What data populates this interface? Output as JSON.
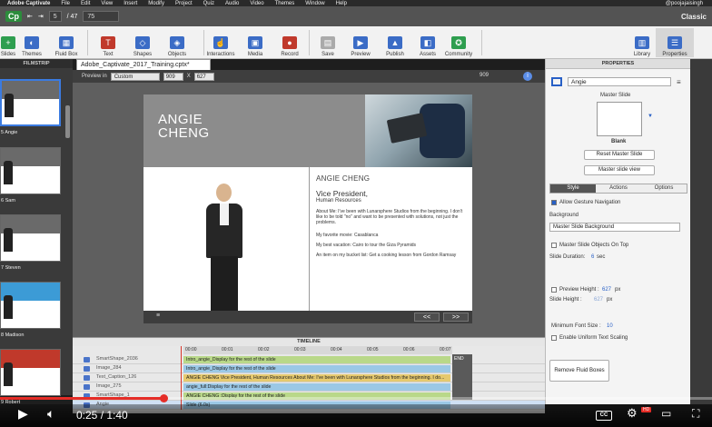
{
  "menubar": {
    "app": "Adobe Captivate",
    "items": [
      "File",
      "Edit",
      "View",
      "Insert",
      "Modify",
      "Project",
      "Quiz",
      "Audio",
      "Video",
      "Themes",
      "Window",
      "Help"
    ],
    "user": "@poojajaisingh"
  },
  "topbar": {
    "logo": "Cp",
    "slide_current": "5",
    "slide_total": "/ 47",
    "zoom": "75",
    "workspace": "Classic"
  },
  "toolbar": {
    "left": [
      {
        "label": "Slides",
        "icon": "plus-icon",
        "color": "#2e9e4f"
      },
      {
        "label": "Themes",
        "icon": "palette-icon",
        "color": "#3b6cc6"
      },
      {
        "label": "Fluid Box",
        "icon": "grid-icon",
        "color": "#3b6cc6"
      },
      {
        "label": "Text",
        "icon": "text-t-icon",
        "color": "#c0392b"
      },
      {
        "label": "Shapes",
        "icon": "shapes-icon",
        "color": "#3b6cc6"
      },
      {
        "label": "Objects",
        "icon": "cube-icon",
        "color": "#3b6cc6"
      },
      {
        "label": "Interactions",
        "icon": "hand-icon",
        "color": "#3b6cc6"
      },
      {
        "label": "Media",
        "icon": "image-icon",
        "color": "#3b6cc6"
      },
      {
        "label": "Record",
        "icon": "mic-icon",
        "color": "#c0392b"
      },
      {
        "label": "Save",
        "icon": "save-icon",
        "color": "#aaaaaa"
      },
      {
        "label": "Preview",
        "icon": "play-icon",
        "color": "#3b6cc6"
      },
      {
        "label": "Publish",
        "icon": "publish-icon",
        "color": "#3b6cc6"
      },
      {
        "label": "Assets",
        "icon": "assets-icon",
        "color": "#3b6cc6"
      },
      {
        "label": "Community",
        "icon": "community-icon",
        "color": "#2e9e4f"
      }
    ],
    "right": [
      {
        "label": "Library",
        "icon": "library-icon",
        "color": "#3b6cc6"
      },
      {
        "label": "Properties",
        "icon": "properties-icon",
        "color": "#3b6cc6"
      }
    ]
  },
  "filmstrip": {
    "title": "FILMSTRIP",
    "thumbs": [
      {
        "label": "5 Angie"
      },
      {
        "label": "6 Sam"
      },
      {
        "label": "7 Steven"
      },
      {
        "label": "8 Madison"
      },
      {
        "label": "9 Robert"
      }
    ]
  },
  "file_tab": "Adobe_Captivate_2017_Training.cptx*",
  "stagebar": {
    "preview_in": "Preview in",
    "device": "Custom",
    "width": "909",
    "x": "X",
    "height": "627",
    "ruler": "909"
  },
  "slide": {
    "name_big_1": "ANGIE",
    "name_big_2": "CHENG",
    "name_small": "ANGIE CHENG",
    "title": "Vice President,",
    "dept": "Human Resources",
    "about": "About Me: I've been with Lunarsphere Studios from the beginning. I don't like to be told \"no\" and want to be presented with solutions, not just the problems.",
    "movie": "My favorite movie: Casablanca",
    "vacation": "My best vacation: Cairo to tour the Giza Pyramids",
    "bucket": "An item on my bucket list: Get a cooking lesson from Gordon Ramsay",
    "prev": "<<",
    "next": ">>",
    "menu": "≡"
  },
  "timeline": {
    "title": "TIMELINE",
    "ticks": [
      "00:00",
      "00:01",
      "00:02",
      "00:03",
      "00:04",
      "00:05",
      "00:06",
      "00:07"
    ],
    "end": "END",
    "rows": [
      {
        "label": "SmartShape_2036",
        "bar": "Intro_angie_Display for the rest of the slide",
        "color": "#b9d889"
      },
      {
        "label": "Image_284",
        "bar": "Intro_angie_Display for the rest of the slide",
        "color": "#9bc8e6"
      },
      {
        "label": "Text_Caption_126",
        "bar": "ANGIE CHENG  Vice President, Human Resources  About Me: I've been with Lunarsphere Studios from the beginning. I do...",
        "color": "#e6c96e"
      },
      {
        "label": "Image_275",
        "bar": "angie_full:Display for the rest of the slide",
        "color": "#9bc8e6"
      },
      {
        "label": "SmartShape_1",
        "bar": "ANGIE CHENG :Display for the rest of the slide",
        "color": "#b9d889"
      },
      {
        "label": "Angie",
        "bar": "Slide (6.0s)",
        "color": "#9bc8e6"
      }
    ]
  },
  "properties": {
    "title": "PROPERTIES",
    "slide_name": "Angie",
    "master_slide_label": "Master Slide",
    "master_name": "Blank",
    "reset_btn": "Reset Master Slide",
    "view_btn": "Master slide view",
    "tabs": [
      "Style",
      "Actions",
      "Options"
    ],
    "allow_gesture": "Allow Gesture Navigation",
    "background_label": "Background",
    "background_value": "Master Slide Background",
    "master_on_top": "Master Slide Objects On Top",
    "duration_label": "Slide Duration:",
    "duration_value": "6",
    "duration_unit": "sec",
    "preview_height": "Preview Height :",
    "preview_height_value": "627",
    "slide_height": "Slide Height :",
    "slide_height_value": "627",
    "px": "px",
    "min_font": "Minimum Font Size :",
    "min_font_value": "10",
    "uniform_text": "Enable Uniform Text Scaling",
    "remove_fluid": "Remove Fluid Boxes"
  },
  "video": {
    "time": "0:25 / 1:40",
    "progress": 0.25,
    "cc": "CC",
    "hd": "HD"
  }
}
